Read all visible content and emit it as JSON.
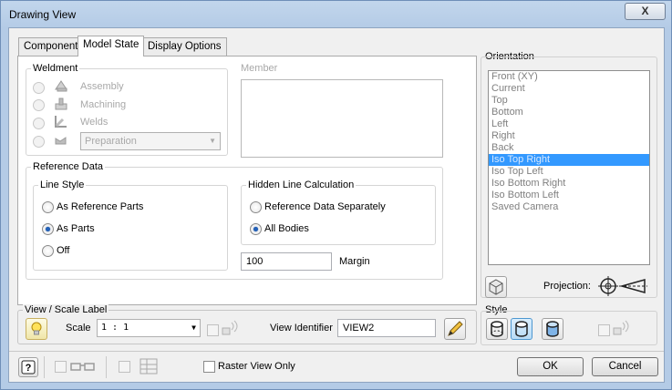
{
  "window": {
    "title": "Drawing View",
    "close_label": "X"
  },
  "tabs": [
    {
      "label": "Component"
    },
    {
      "label": "Model State"
    },
    {
      "label": "Display Options"
    }
  ],
  "weldment": {
    "label": "Weldment",
    "options": [
      {
        "label": "Assembly",
        "icon": "assembly-icon"
      },
      {
        "label": "Machining",
        "icon": "machining-icon"
      },
      {
        "label": "Welds",
        "icon": "welds-icon"
      }
    ],
    "preparation_value": "Preparation"
  },
  "member": {
    "label": "Member"
  },
  "reference_data": {
    "label": "Reference Data",
    "line_style": {
      "label": "Line Style",
      "options": [
        "As Reference Parts",
        "As Parts",
        "Off"
      ],
      "selected": "As Parts"
    },
    "hidden_line": {
      "label": "Hidden Line Calculation",
      "options": [
        "Reference Data Separately",
        "All Bodies"
      ],
      "selected": "All Bodies"
    },
    "margin_value": "100",
    "margin_label": "Margin"
  },
  "view_scale": {
    "label": "View / Scale Label",
    "scale_label": "Scale",
    "scale_value": "1 : 1",
    "identifier_label": "View Identifier",
    "identifier_value": "VIEW2"
  },
  "orientation": {
    "label": "Orientation",
    "items": [
      "Front (XY)",
      "Current",
      "Top",
      "Bottom",
      "Left",
      "Right",
      "Back",
      "Iso Top Right",
      "Iso Top Left",
      "Iso Bottom Right",
      "Iso Bottom Left",
      "Saved Camera"
    ],
    "selected": "Iso Top Right",
    "projection_label": "Projection:"
  },
  "style": {
    "label": "Style"
  },
  "footer": {
    "raster_label": "Raster View Only",
    "ok_label": "OK",
    "cancel_label": "Cancel"
  },
  "colors": {
    "selection": "#3399ff",
    "radio_dot": "#2361b8",
    "frame": "#b4cbe6"
  }
}
